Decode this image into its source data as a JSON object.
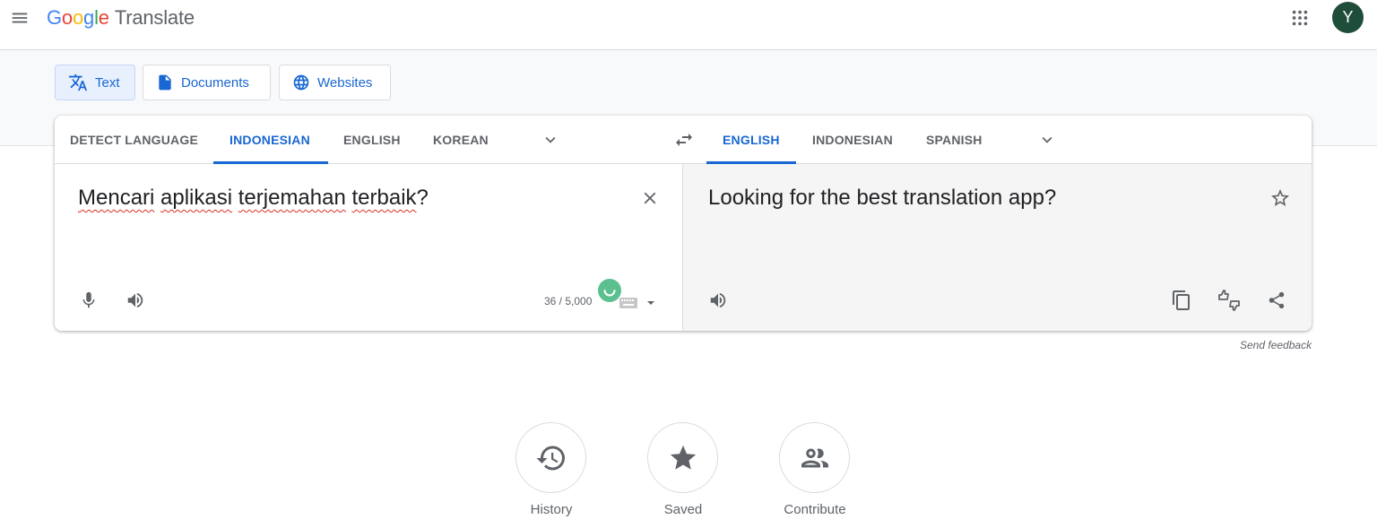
{
  "header": {
    "logo_letters": [
      "G",
      "o",
      "o",
      "g",
      "l",
      "e"
    ],
    "logo_colors": [
      "#4285f4",
      "#ea4335",
      "#fbbc05",
      "#4285f4",
      "#34a853",
      "#ea4335"
    ],
    "product_name": "Translate",
    "avatar_initial": "Y"
  },
  "mode_tabs": [
    {
      "label": "Text",
      "icon": "translate-icon",
      "active": true
    },
    {
      "label": "Documents",
      "icon": "document-icon",
      "active": false
    },
    {
      "label": "Websites",
      "icon": "globe-icon",
      "active": false
    }
  ],
  "source_languages": [
    "DETECT LANGUAGE",
    "INDONESIAN",
    "ENGLISH",
    "KOREAN"
  ],
  "source_active": "INDONESIAN",
  "target_languages": [
    "ENGLISH",
    "INDONESIAN",
    "SPANISH"
  ],
  "target_active": "ENGLISH",
  "source": {
    "words": [
      "Mencari",
      "aplikasi",
      "terjemahan",
      "terbaik"
    ],
    "punct": "?",
    "char_count": "36 / 5,000"
  },
  "target": {
    "text": "Looking for the best translation app?"
  },
  "feedback_label": "Send feedback",
  "actions": [
    {
      "label": "History",
      "icon": "history-icon"
    },
    {
      "label": "Saved",
      "icon": "star-icon"
    },
    {
      "label": "Contribute",
      "icon": "people-icon"
    }
  ],
  "colors": {
    "accent": "#1967d2",
    "avatar": "#1e4d3a",
    "spinner": "#5bbf8f",
    "spellcheck": "#d93025"
  }
}
